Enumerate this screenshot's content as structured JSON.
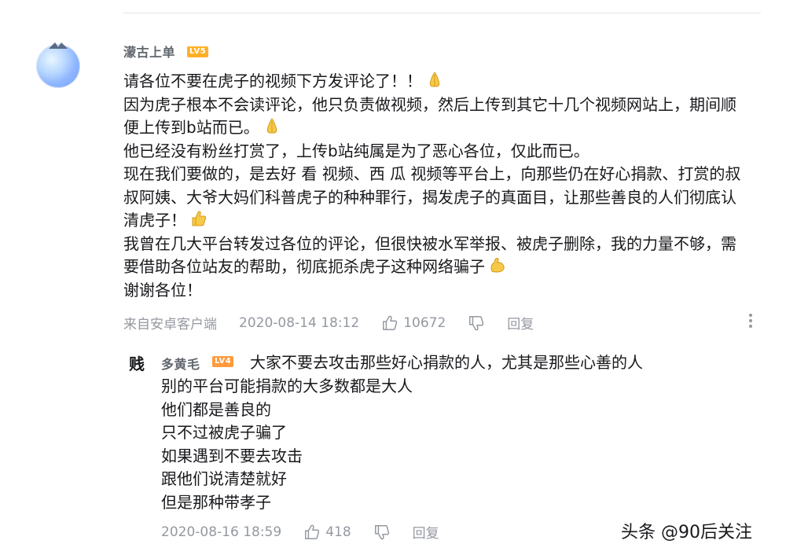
{
  "main_comment": {
    "username": "濛古上单",
    "level": "LV5",
    "lines": [
      "请各位不要在虎子的视频下方发评论了！！",
      "因为虎子根本不会读评论，他只负责做视频，然后上传到其它十几个视频网站上，期间顺",
      "便上传到b站而已。",
      "他已经没有粉丝打赏了，上传b站纯属是为了恶心各位，仅此而已。",
      "现在我们要做的，是去好 看 视频、西 瓜 视频等平台上，向那些仍在好心捐款、打赏的叔",
      "叔阿姨、大爷大妈们科普虎子的种种罪行，揭发虎子的真面目，让那些善良的人们彻底认",
      "清虎子！",
      "我曾在几大平台转发过各位的评论，但很快被水军举报、被虎子删除，我的力量不够，需",
      "要借助各位站友的帮助，彻底扼杀虎子这种网络骗子",
      "谢谢各位！"
    ],
    "source": "来自安卓客户端",
    "timestamp": "2020-08-14 18:12",
    "likes": "10672",
    "reply_label": "回复"
  },
  "reply_comment": {
    "avatar_char": "贱",
    "username": "多黄毛",
    "level": "LV4",
    "lines": [
      "大家不要去攻击那些好心捐款的人，尤其是那些心善的人",
      "别的平台可能捐款的大多数都是大人",
      "他们都是善良的",
      "只不过被虎子骗了",
      "如果遇到不要去攻击",
      "跟他们说清楚就好",
      "但是那种带孝子"
    ],
    "timestamp": "2020-08-16 18:59",
    "likes": "418",
    "reply_label": "回复"
  },
  "watermark": "头条 @90后关注",
  "colors": {
    "level5": "#ffb027",
    "level4": "#ff9a3c",
    "meta_gray": "#9499a0"
  }
}
